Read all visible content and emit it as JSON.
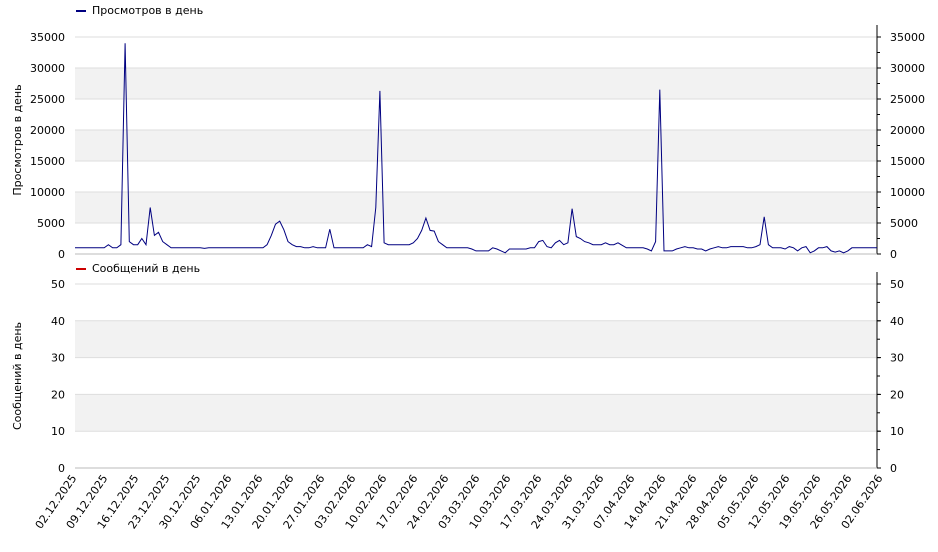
{
  "colors": {
    "views": "#000080",
    "messages": "#cc0000",
    "band": "#f2f2f2",
    "grid": "#dddddd"
  },
  "x_tick_labels": [
    "02.12.2025",
    "09.12.2025",
    "16.12.2025",
    "23.12.2025",
    "30.12.2025",
    "06.01.2026",
    "13.01.2026",
    "20.01.2026",
    "27.01.2026",
    "03.02.2026",
    "10.02.2026",
    "17.02.2026",
    "24.02.2026",
    "03.03.2026",
    "10.03.2026",
    "17.03.2026",
    "24.03.2026",
    "31.03.2026",
    "07.04.2026",
    "14.04.2026",
    "21.04.2026",
    "28.04.2026",
    "05.05.2026",
    "12.05.2026",
    "19.05.2026",
    "26.05.2026",
    "02.06.2026"
  ],
  "chart_data": [
    {
      "type": "line",
      "title": "",
      "legend": "Просмотров в день",
      "ylabel": "Просмотров в день",
      "xlabel": "",
      "ylim": [
        0,
        35000
      ],
      "yticks": [
        "0",
        "5000",
        "10000",
        "15000",
        "20000",
        "25000",
        "30000",
        "35000"
      ],
      "grid": true,
      "legend_placement": "top-left",
      "x_start": "02.12.2025",
      "x_end": "02.06.2026",
      "series": [
        {
          "name": "Просмотров в день",
          "values": [
            1000,
            1000,
            1000,
            1000,
            1000,
            1000,
            1000,
            1000,
            1500,
            1000,
            1000,
            1500,
            34000,
            2000,
            1500,
            1500,
            2500,
            1500,
            7500,
            3000,
            3500,
            2000,
            1500,
            1000,
            1000,
            1000,
            1000,
            1000,
            1000,
            1000,
            1000,
            900,
            1000,
            1000,
            1000,
            1000,
            1000,
            1000,
            1000,
            1000,
            1000,
            1000,
            1000,
            1000,
            1000,
            1000,
            1500,
            3000,
            4800,
            5300,
            3900,
            2000,
            1500,
            1200,
            1200,
            1000,
            1000,
            1200,
            1000,
            1000,
            1000,
            4000,
            1000,
            1000,
            1000,
            1000,
            1000,
            1000,
            1000,
            1000,
            1500,
            1200,
            7500,
            26300,
            1800,
            1500,
            1500,
            1500,
            1500,
            1500,
            1500,
            1800,
            2500,
            3800,
            5800,
            3800,
            3700,
            2000,
            1500,
            1000,
            1000,
            1000,
            1000,
            1000,
            1000,
            800,
            500,
            500,
            500,
            500,
            1000,
            800,
            500,
            200,
            800,
            800,
            800,
            800,
            800,
            1000,
            1000,
            2000,
            2200,
            1200,
            1000,
            1800,
            2200,
            1500,
            1800,
            7300,
            2800,
            2500,
            2000,
            1800,
            1500,
            1500,
            1500,
            1800,
            1500,
            1500,
            1800,
            1400,
            1000,
            1000,
            1000,
            1000,
            1000,
            800,
            500,
            2000,
            26500,
            500,
            500,
            500,
            800,
            1000,
            1200,
            1000,
            1000,
            800,
            800,
            500,
            800,
            1000,
            1200,
            1000,
            1000,
            1200,
            1200,
            1200,
            1200,
            1000,
            1000,
            1200,
            1500,
            6000,
            1500,
            1000,
            1000,
            1000,
            800,
            1200,
            1000,
            500,
            1000,
            1200,
            200,
            500,
            1000,
            1000,
            1200,
            500,
            300,
            500,
            200,
            500,
            1000,
            1000,
            1000,
            1000,
            1000,
            1000,
            1000
          ]
        }
      ]
    },
    {
      "type": "line",
      "title": "",
      "legend": "Сообщений в день",
      "ylabel": "Сообщений в день",
      "xlabel": "",
      "ylim": [
        0,
        50
      ],
      "yticks": [
        "0",
        "10",
        "20",
        "30",
        "40",
        "50"
      ],
      "grid": true,
      "legend_placement": "top-left",
      "x_start": "02.12.2025",
      "x_end": "02.06.2026",
      "series": [
        {
          "name": "Сообщений в день",
          "values": []
        }
      ]
    }
  ]
}
